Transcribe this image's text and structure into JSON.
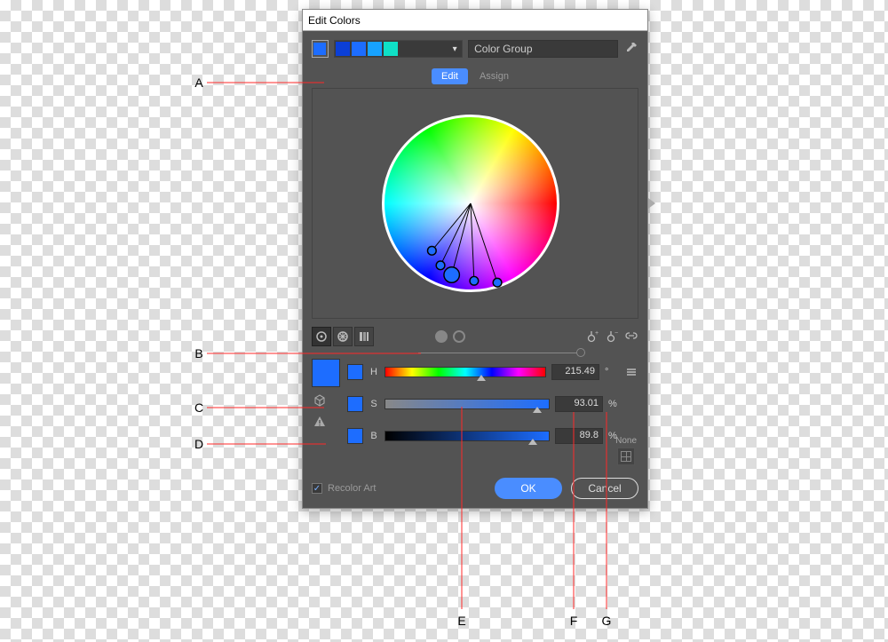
{
  "dialog": {
    "title": "Edit Colors",
    "active_swatch_color": "#1d6dff",
    "group_swatches": [
      "#0b3fd6",
      "#1d6dff",
      "#17a2ff",
      "#0fe0c6"
    ],
    "name_field": "Color Group",
    "tabs": {
      "edit": "Edit",
      "assign": "Assign"
    },
    "hsb": {
      "h_label": "H",
      "h_value": "215.49",
      "h_unit": "°",
      "s_label": "S",
      "s_value": "93.01",
      "s_unit": "%",
      "b_label": "B",
      "b_value": "89.8",
      "b_unit": "%"
    },
    "none_label": "None",
    "recolor_label": "Recolor Art",
    "ok_label": "OK",
    "cancel_label": "Cancel"
  },
  "annotations": {
    "A": "A",
    "B": "B",
    "C": "C",
    "D": "D",
    "E": "E",
    "F": "F",
    "G": "G"
  }
}
